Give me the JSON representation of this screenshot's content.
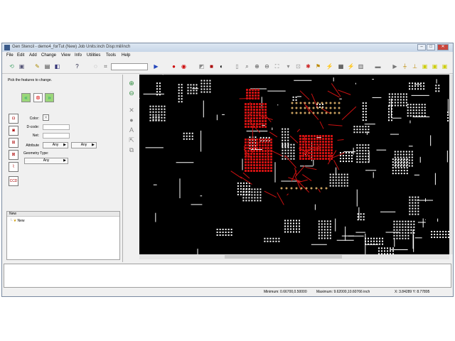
{
  "window": {
    "title": "Gen Stencil - demo4_forTut (New)  Job Units:inch Disp:mil/inch",
    "controls": [
      "–",
      "□",
      "✕"
    ]
  },
  "menu": [
    "File",
    "Edit",
    "Add",
    "Change",
    "View",
    "Info",
    "Utilities",
    "Tools",
    "Help"
  ],
  "panel": {
    "instruction": "Pick the features to change.",
    "color_label": "Color:",
    "dcode_label": "D-code:",
    "net_label": "Net:",
    "attribute_label": "Attribute",
    "attr_value_1": "Any",
    "attr_value_2": "Any",
    "geometry_label": "Geometry Type:",
    "geometry_value": "Any",
    "ccd_icon_text": "CCD"
  },
  "tree": {
    "header": "New",
    "item": "New"
  },
  "status": {
    "minimum": "Minimum: 0.66700,0.50000",
    "maximum": "Maximum: 9.62000,10.60766 inch",
    "coords": "X: 3.84289 Y: 8.77895"
  },
  "colors": {
    "canvas_bg": "#000000",
    "pcb_white": "#ffffff",
    "pcb_red": "#cc1111",
    "pcb_gold": "#c8a060",
    "title_bar": "#c7d6e8"
  }
}
